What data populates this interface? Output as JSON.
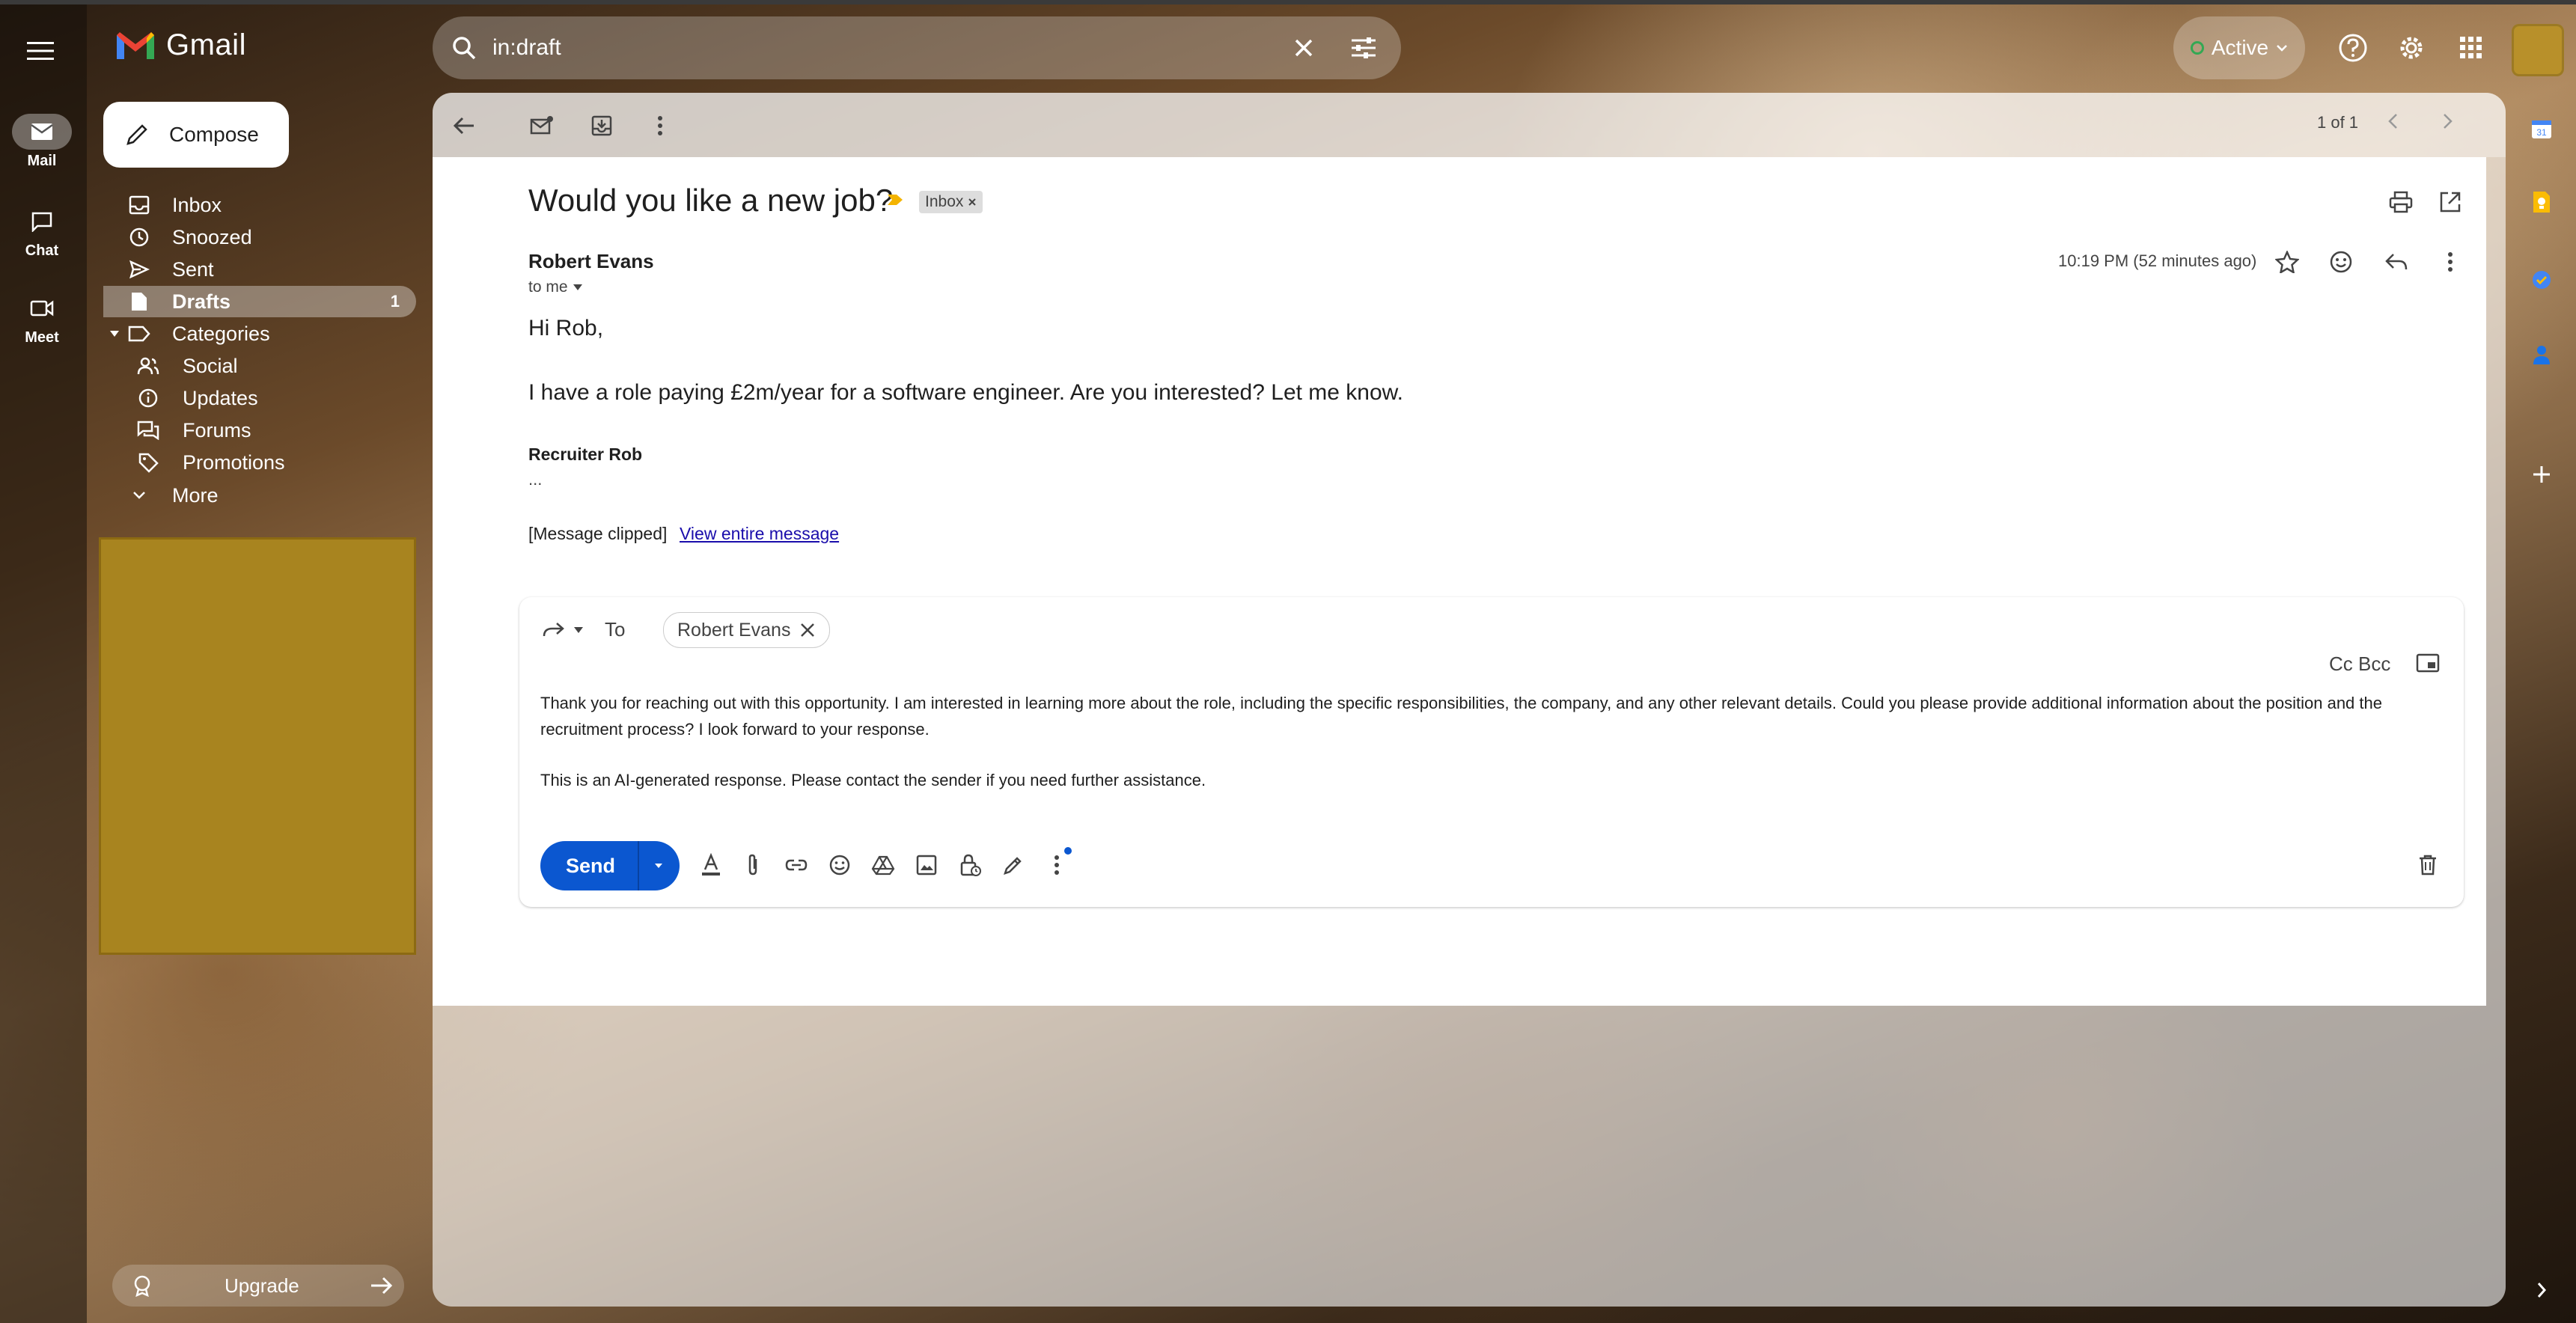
{
  "app": {
    "name": "Gmail",
    "rail": [
      {
        "label": "Mail",
        "icon": "mail-icon",
        "active": true
      },
      {
        "label": "Chat",
        "icon": "chat-icon",
        "active": false
      },
      {
        "label": "Meet",
        "icon": "meet-icon",
        "active": false
      }
    ]
  },
  "search": {
    "value": "in:draft"
  },
  "status": {
    "label": "Active"
  },
  "compose_label": "Compose",
  "nav": [
    {
      "label": "Inbox",
      "icon": "inbox-icon"
    },
    {
      "label": "Snoozed",
      "icon": "clock-icon"
    },
    {
      "label": "Sent",
      "icon": "send-icon"
    },
    {
      "label": "Drafts",
      "icon": "draft-icon",
      "count": "1",
      "active": true
    },
    {
      "label": "Categories",
      "icon": "label-icon"
    },
    {
      "label": "Social",
      "icon": "people-icon"
    },
    {
      "label": "Updates",
      "icon": "info-icon"
    },
    {
      "label": "Forums",
      "icon": "forum-icon"
    },
    {
      "label": "Promotions",
      "icon": "tag-icon"
    },
    {
      "label": "More",
      "icon": "chevron-down-icon"
    }
  ],
  "upgrade_label": "Upgrade",
  "pager": "1 of 1",
  "message": {
    "subject": "Would you like a new job?",
    "label": "Inbox",
    "sender": "Robert Evans",
    "to": "to me",
    "time": "10:19 PM (52 minutes ago)",
    "greeting": "Hi Rob,",
    "body": "I have a role paying £2m/year for a software engineer. Are you interested? Let me know.",
    "signature": "Recruiter Rob",
    "ellipsis": "...",
    "clipped": "[Message clipped]",
    "view_link": "View entire message"
  },
  "reply": {
    "to_label": "To",
    "recipient": "Robert Evans",
    "ccbcc": "Cc Bcc",
    "text1": "Thank you for reaching out with this opportunity. I am interested in learning more about the role, including the specific responsibilities, the company, and any other relevant details. Could you please provide additional information about the position and the recruitment process? I look forward to your response.",
    "text2": "This is an AI-generated response. Please contact the sender if you need further assistance.",
    "send_label": "Send"
  },
  "colors": {
    "accent": "#0b57d0",
    "active_green": "#34a853"
  }
}
